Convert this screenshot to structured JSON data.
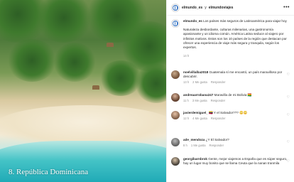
{
  "photo": {
    "caption": "8. República Dominicana"
  },
  "header": {
    "username": "elmundo_es",
    "separator": "y",
    "collaborator": "elmundoviajes",
    "more_icon": "more-horizontal-icon"
  },
  "caption": {
    "username": "elmundo_es",
    "intro": "Los países más seguros de Latinoamérica para viajar hoy",
    "text": "Naturaleza desbordante, culturas milenarias, una gastronomía apasionante y un idioma común. América Latina seduce al viajero por infinitos motivos. Estos son los 10 países de la región que destacan por ofrecer una experiencia de viaje más segura y tranquila, según los expertos.",
    "time": "14 h"
  },
  "comments": [
    {
      "username": "noelvillalba2018",
      "text": "Guatemala sí me encantó, un país maravilloso por descubrir.",
      "time": "13 h",
      "likes": "2 Me gusta",
      "reply": "Responder"
    },
    {
      "username": "andreaarrobana247",
      "text": "Maravilla de mi Bolivia 🇧🇴",
      "time": "11 h",
      "likes": "3 Me gusta",
      "reply": "Responder"
    },
    {
      "username": "javierdemiguel_",
      "text": "🇻🇪 Y el Salvador??? 😳😳",
      "time": "12 h",
      "likes": "4 Me gusta",
      "reply": "Responder"
    },
    {
      "username": "ade_mendoza",
      "text": "¿Y El Salvador?",
      "time": "8 h",
      "likes": "1 Me gusta",
      "reply": "Responder"
    },
    {
      "username": "georgibarnbrok",
      "text": "Gente, mejor viajemos a España que es súper seguro, hay un lugar muy bonito que se llama Ceuta que la nanan tranmila",
      "time": "",
      "likes": "",
      "reply": ""
    }
  ],
  "colors": {
    "text": "#262626",
    "muted": "#8e8e8e",
    "border": "#efefef"
  }
}
